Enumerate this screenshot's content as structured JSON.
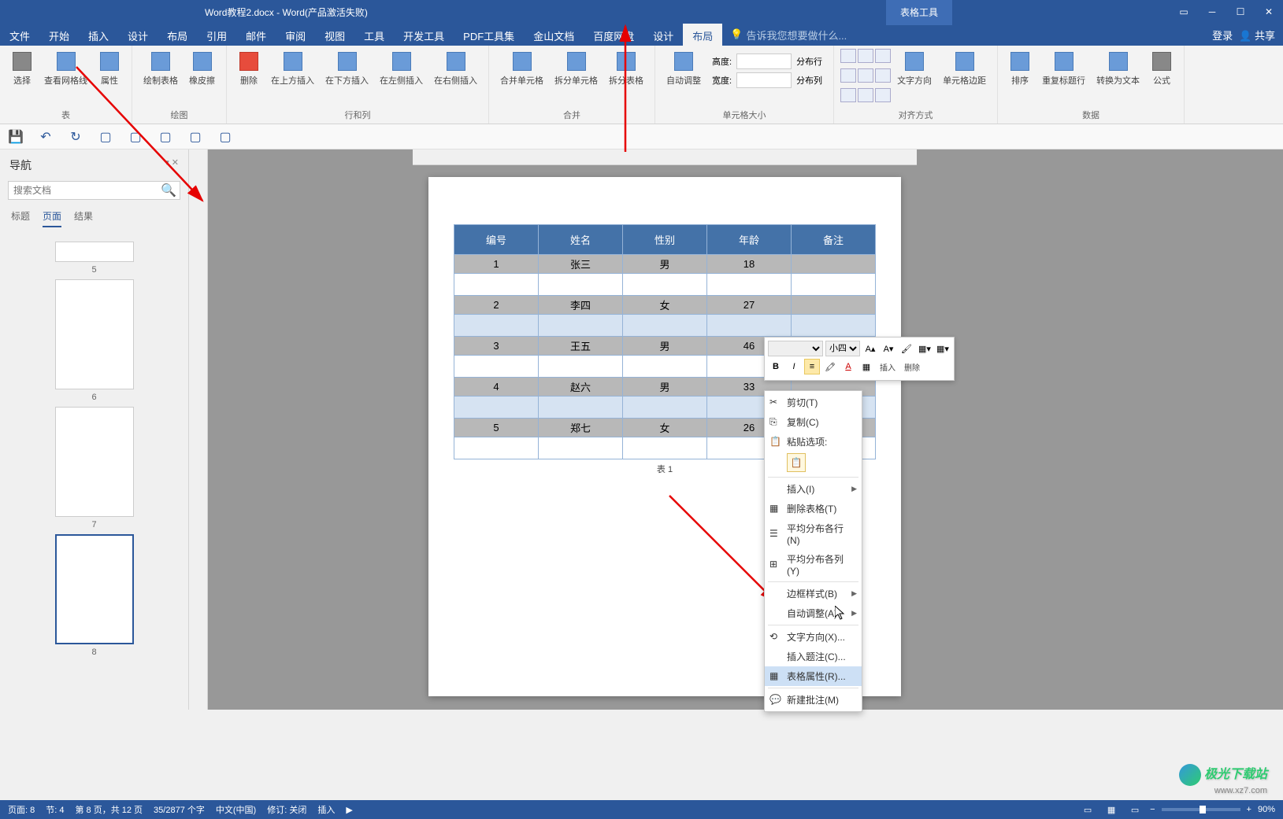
{
  "titlebar": {
    "filename": "Word教程2.docx - Word(产品激活失败)",
    "tabletools": "表格工具"
  },
  "menutabs": {
    "file": "文件",
    "home": "开始",
    "insert": "插入",
    "design": "设计",
    "layout": "布局",
    "references": "引用",
    "mailings": "邮件",
    "review": "审阅",
    "view": "视图",
    "tools": "工具",
    "developer": "开发工具",
    "pdf": "PDF工具集",
    "wps": "金山文档",
    "baidu": "百度网盘",
    "tdesign": "设计",
    "tlayout": "布局",
    "tellme_placeholder": "告诉我您想要做什么...",
    "login": "登录",
    "share": "共享"
  },
  "ribbon": {
    "table": {
      "label": "表",
      "select": "选择",
      "gridlines": "查看网格线",
      "properties": "属性"
    },
    "draw": {
      "label": "绘图",
      "draw": "绘制表格",
      "eraser": "橡皮擦"
    },
    "rowscols": {
      "label": "行和列",
      "delete": "删除",
      "above": "在上方插入",
      "below": "在下方插入",
      "left": "在左侧插入",
      "right": "在右侧插入"
    },
    "merge": {
      "label": "合并",
      "merge": "合并单元格",
      "split": "拆分单元格",
      "splittable": "拆分表格"
    },
    "cellsize": {
      "label": "单元格大小",
      "autofit": "自动调整",
      "height": "高度:",
      "width": "宽度:",
      "distrows": "分布行",
      "distcols": "分布列"
    },
    "alignment": {
      "label": "对齐方式",
      "textdir": "文字方向",
      "margins": "单元格边距"
    },
    "data": {
      "label": "数据",
      "sort": "排序",
      "repeathdr": "重复标题行",
      "convert": "转换为文本",
      "formula": "公式"
    }
  },
  "nav": {
    "title": "导航",
    "search_placeholder": "搜索文档",
    "tabs": {
      "headings": "标题",
      "pages": "页面",
      "results": "结果"
    },
    "thumbs": [
      "5",
      "6",
      "7",
      "8"
    ]
  },
  "table": {
    "headers": [
      "编号",
      "姓名",
      "性别",
      "年龄",
      "备注"
    ],
    "rows": [
      {
        "no": "1",
        "name": "张三",
        "gender": "男",
        "age": "18"
      },
      {
        "no": "2",
        "name": "李四",
        "gender": "女",
        "age": "27"
      },
      {
        "no": "3",
        "name": "王五",
        "gender": "男",
        "age": "46"
      },
      {
        "no": "4",
        "name": "赵六",
        "gender": "男",
        "age": "33"
      },
      {
        "no": "5",
        "name": "郑七",
        "gender": "女",
        "age": "26"
      }
    ],
    "caption": "表 1"
  },
  "minitoolbar": {
    "fontsize": "小四",
    "insert": "插入",
    "delete": "删除"
  },
  "ctxmenu": {
    "cut": "剪切(T)",
    "copy": "复制(C)",
    "pasteopts": "粘贴选项:",
    "insert": "插入(I)",
    "deltable": "删除表格(T)",
    "distrows": "平均分布各行(N)",
    "distcols": "平均分布各列(Y)",
    "borderstyle": "边框样式(B)",
    "autofit": "自动调整(A)",
    "textdir": "文字方向(X)...",
    "insertcaption": "插入题注(C)...",
    "tableprops": "表格属性(R)...",
    "newcomment": "新建批注(M)"
  },
  "statusbar": {
    "page": "页面: 8",
    "section": "节: 4",
    "pageof": "第 8 页，共 12 页",
    "words": "35/2877 个字",
    "lang": "中文(中国)",
    "revisions": "修订: 关闭",
    "insert": "插入",
    "zoom": "90%"
  },
  "watermark": {
    "name": "极光下载站",
    "url": "www.xz7.com"
  },
  "chart_data": {
    "type": "table",
    "title": "表 1",
    "columns": [
      "编号",
      "姓名",
      "性别",
      "年龄",
      "备注"
    ],
    "rows": [
      [
        "1",
        "张三",
        "男",
        "18",
        ""
      ],
      [
        "2",
        "李四",
        "女",
        "27",
        ""
      ],
      [
        "3",
        "王五",
        "男",
        "46",
        ""
      ],
      [
        "4",
        "赵六",
        "男",
        "33",
        ""
      ],
      [
        "5",
        "郑七",
        "女",
        "26",
        ""
      ]
    ]
  }
}
